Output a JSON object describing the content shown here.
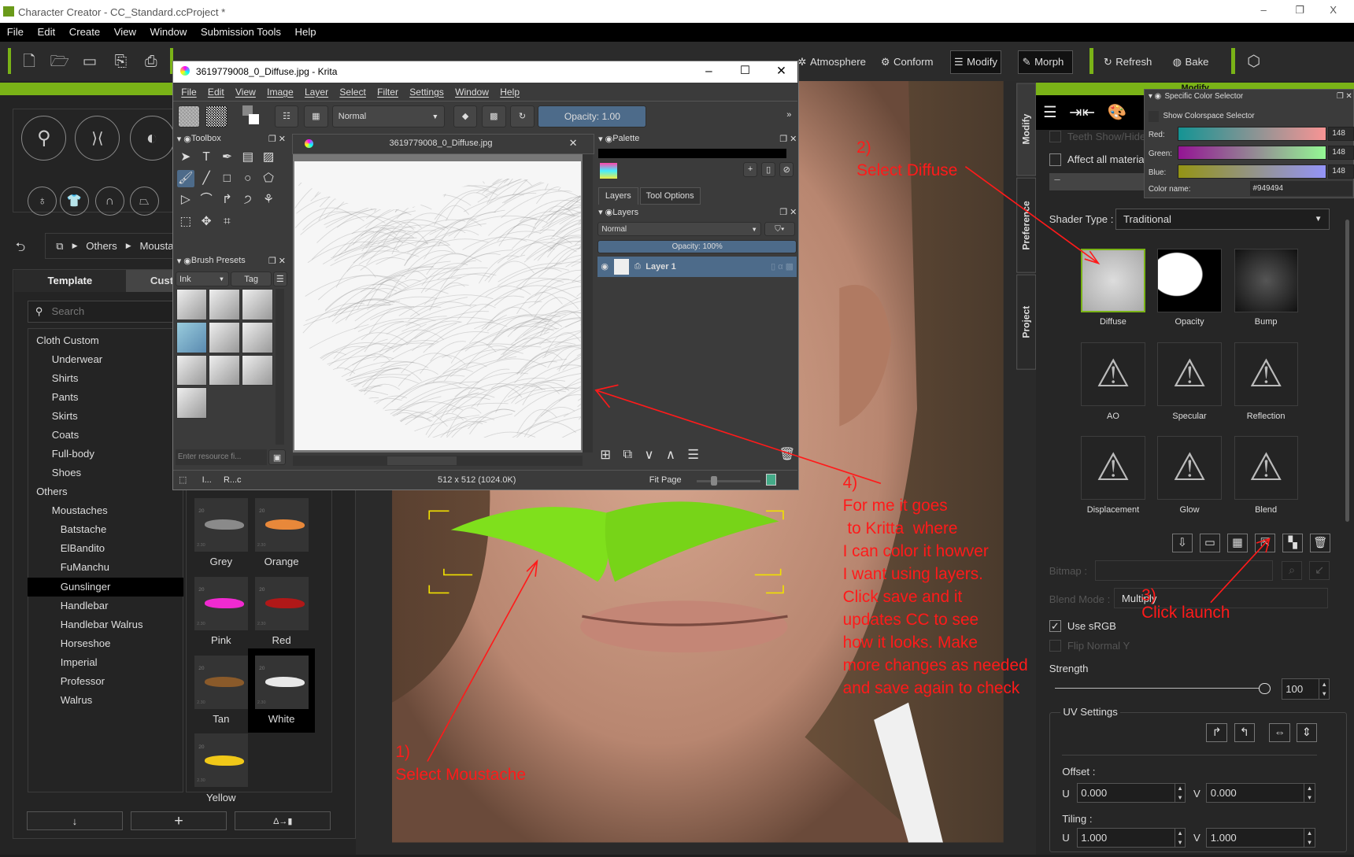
{
  "app": {
    "title": "Character Creator - CC_Standard.ccProject *",
    "window_controls": {
      "minimize": "–",
      "restore": "❐",
      "close": "X"
    },
    "menu": [
      "File",
      "Edit",
      "Create",
      "View",
      "Window",
      "Submission Tools",
      "Help"
    ],
    "accent_color": "#7ab317"
  },
  "toolbar": {
    "file_icons": [
      "new-file-icon",
      "open-folder-icon",
      "save-icon",
      "export-icon",
      "import-icon"
    ],
    "labeled": [
      {
        "label": "Atmosphere",
        "icon": "atmosphere-icon"
      },
      {
        "label": "Conform",
        "icon": "conform-icon"
      },
      {
        "label": "Modify",
        "icon": "sliders-icon",
        "active": true
      },
      {
        "label": "Morph",
        "icon": "morph-icon",
        "active": true
      },
      {
        "label": "Refresh",
        "icon": "refresh-icon"
      },
      {
        "label": "Bake",
        "icon": "bake-icon"
      }
    ]
  },
  "left_panel": {
    "breadcrumb": [
      "Others",
      "Mousta"
    ],
    "tabs": [
      "Template",
      "Cust"
    ],
    "search_placeholder": "Search",
    "tree": [
      {
        "label": "Cloth Custom",
        "level": 0,
        "expanded": true
      },
      {
        "label": "Underwear",
        "level": 1
      },
      {
        "label": "Shirts",
        "level": 1
      },
      {
        "label": "Pants",
        "level": 1
      },
      {
        "label": "Skirts",
        "level": 1
      },
      {
        "label": "Coats",
        "level": 1
      },
      {
        "label": "Full-body",
        "level": 1
      },
      {
        "label": "Shoes",
        "level": 1
      },
      {
        "label": "Others",
        "level": 0,
        "expanded": true
      },
      {
        "label": "Moustaches",
        "level": 1,
        "expanded": true
      },
      {
        "label": "Batstache",
        "level": 2
      },
      {
        "label": "ElBandito",
        "level": 2
      },
      {
        "label": "FuManchu",
        "level": 2
      },
      {
        "label": "Gunslinger",
        "level": 2,
        "selected": true
      },
      {
        "label": "Handlebar",
        "level": 2
      },
      {
        "label": "Handlebar Walrus",
        "level": 2
      },
      {
        "label": "Horseshoe",
        "level": 2
      },
      {
        "label": "Imperial",
        "level": 2
      },
      {
        "label": "Professor",
        "level": 2
      },
      {
        "label": "Walrus",
        "level": 2
      }
    ],
    "thumbnails": [
      {
        "label": "Grey",
        "color": "#8a8a8a"
      },
      {
        "label": "Orange",
        "color": "#e8883a"
      },
      {
        "label": "Pink",
        "color": "#f02ad0"
      },
      {
        "label": "Red",
        "color": "#b01818"
      },
      {
        "label": "Tan",
        "color": "#8a5a2a"
      },
      {
        "label": "White",
        "color": "#e8e8e8",
        "selected": true
      },
      {
        "label": "Yellow",
        "color": "#f0c818"
      }
    ],
    "thumb_badge": "20",
    "thumb_version": "2.30",
    "bottom_buttons": [
      "↓",
      "+",
      "Δ→▮"
    ]
  },
  "krita": {
    "title": "3619779008_0_Diffuse.jpg - Krita",
    "menu": [
      "File",
      "Edit",
      "View",
      "Image",
      "Layer",
      "Select",
      "Filter",
      "Settings",
      "Window",
      "Help"
    ],
    "blend_mode": "Normal",
    "opacity": "Opacity:  1.00",
    "toolbox_title": "Toolbox",
    "brush_presets_title": "Brush Presets",
    "brush_tag": "Ink",
    "tag_label": "Tag",
    "resource_filter_placeholder": "Enter resource fi...",
    "document_tab": "3619779008_0_Diffuse.jpg",
    "palette_title": "Palette",
    "docker_tabs": [
      "Layers",
      "Tool Options"
    ],
    "layers_title": "Layers",
    "layer_blend": "Normal",
    "layer_opacity": "Opacity:  100%",
    "layers": [
      {
        "name": "Layer 1",
        "visible": true,
        "selected": true
      }
    ],
    "status": {
      "left1": "I...",
      "left2": "R...c",
      "size": "512 x 512 (1024.0K)",
      "zoom": "Fit Page"
    }
  },
  "right_tabs": [
    "Modify",
    "Preference",
    "Project"
  ],
  "right_panel": {
    "header": "Modify",
    "teeth_label": "Teeth Show/Hide",
    "affect_all_label": "Affect all materials",
    "shader_type_label": "Shader Type :",
    "shader_type": "Traditional",
    "textures": [
      {
        "label": "Diffuse",
        "state": "loaded"
      },
      {
        "label": "Opacity",
        "state": "loaded"
      },
      {
        "label": "Bump",
        "state": "loaded"
      },
      {
        "label": "AO",
        "state": "missing"
      },
      {
        "label": "Specular",
        "state": "missing"
      },
      {
        "label": "Reflection",
        "state": "missing"
      },
      {
        "label": "Displacement",
        "state": "missing"
      },
      {
        "label": "Glow",
        "state": "missing"
      },
      {
        "label": "Blend",
        "state": "missing"
      }
    ],
    "texture_actions": [
      "load-icon",
      "save-icon",
      "grid-icon",
      "launch-icon",
      "checker-icon",
      "trash-icon"
    ],
    "bitmap_label": "Bitmap :",
    "blend_mode_label": "Blend Mode :",
    "blend_mode": "Multiply",
    "use_srgb_label": "Use sRGB",
    "use_srgb": true,
    "flip_normal_label": "Flip Normal Y",
    "strength_label": "Strength",
    "strength": 100,
    "strength_text": "100",
    "uv_title": "UV Settings",
    "offset_label": "Offset :",
    "tiling_label": "Tiling :",
    "u_label": "U",
    "v_label": "V",
    "offset_u": "0.000",
    "offset_v": "0.000",
    "tiling_u": "1.000",
    "tiling_v": "1.000"
  },
  "color_selector": {
    "title": "Specific Color Selector",
    "show_colorspace": "Show Colorspace Selector",
    "red_label": "Red:",
    "red": "148",
    "green_label": "Green:",
    "green": "148",
    "blue_label": "Blue:",
    "blue": "148",
    "color_name_label": "Color name:",
    "color_name": "#949494"
  },
  "annotations": {
    "step1": "1)\nSelect Moustache",
    "step2": "2)\nSelect Diffuse",
    "step3": "3)\nClick launch",
    "step4": "4)\nFor me it goes\n to Kritta  where\nI can color it howver\nI want using layers.\nClick save and it\nupdates CC to see\nhow it looks. Make\nmore changes as needed\nand save again to check",
    "color": "#ff1a1a"
  }
}
